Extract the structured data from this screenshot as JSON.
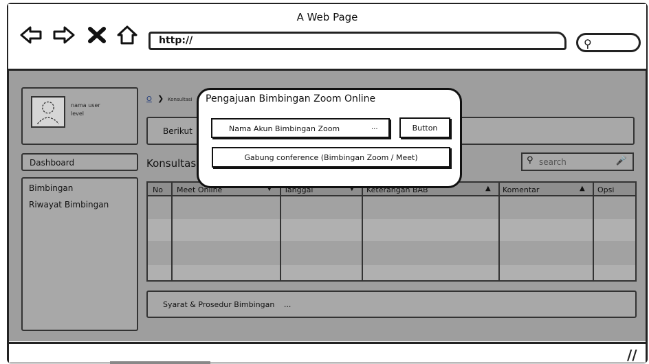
{
  "browser": {
    "title": "A Web Page",
    "url": "http://"
  },
  "sidebar": {
    "user_name": "nama user",
    "user_level": "level",
    "dashboard": "Dashboard",
    "items": [
      {
        "label": "Bimbingan"
      },
      {
        "label": "Riwayat Bimbingan"
      }
    ]
  },
  "main": {
    "breadcrumb_home": "O",
    "breadcrumb_current": "Konsultasi",
    "info_text": "Berikut",
    "section_title": "Konsultas",
    "search_placeholder": "search",
    "table": {
      "columns": [
        "No",
        "Meet Online",
        "Tanggal",
        "Keterangan BAB",
        "Komentar",
        "Opsi"
      ],
      "rows": []
    },
    "syarat_text": "Syarat & Prosedur Bimbingan",
    "syarat_dots": "..."
  },
  "modal": {
    "title": "Pengajuan Bimbingan Zoom Online",
    "account_field": "Nama Akun Bimbingan Zoom",
    "account_dots": "...",
    "button_label": "Button",
    "join_label": "Gabung conference (Bimbingan Zoom / Meet)"
  }
}
